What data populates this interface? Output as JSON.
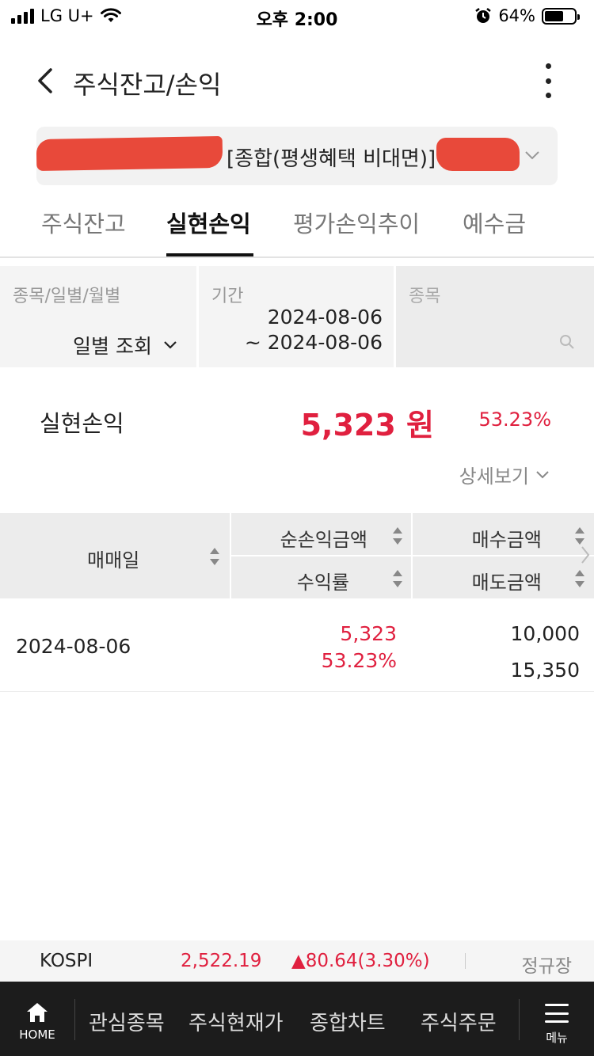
{
  "status_bar": {
    "carrier": "LG U+",
    "time": "오후 2:00",
    "battery": "64%",
    "battery_level": 0.64
  },
  "header": {
    "title": "주식잔고/손익"
  },
  "account": {
    "name": "[종합(평생혜택 비대면)]"
  },
  "tabs": [
    {
      "label": "주식잔고",
      "active": false
    },
    {
      "label": "실현손익",
      "active": true
    },
    {
      "label": "평가손익추이",
      "active": false
    },
    {
      "label": "예수금",
      "active": false
    }
  ],
  "filters": {
    "mode_label": "종목/일별/월별",
    "mode_value": "일별 조회",
    "period_label": "기간",
    "period_from": "2024-08-06",
    "period_to": "~ 2024-08-06",
    "stock_label": "종목"
  },
  "summary": {
    "label": "실현손익",
    "amount": "5,323 원",
    "percent": "53.23%",
    "detail_label": "상세보기"
  },
  "table": {
    "headers": {
      "date": "매매일",
      "net_profit": "순손익금액",
      "return_rate": "수익률",
      "buy_amount": "매수금액",
      "sell_amount": "매도금액"
    },
    "rows": [
      {
        "date": "2024-08-06",
        "net_profit": "5,323",
        "return_rate": "53.23%",
        "buy_amount": "10,000",
        "sell_amount": "15,350"
      }
    ]
  },
  "ticker": {
    "name": "KOSPI",
    "value": "2,522.19",
    "change": "▲80.64(3.30%)",
    "status": "정규장"
  },
  "bottom_nav": {
    "home": "HOME",
    "items": [
      "관심종목",
      "주식현재가",
      "종합차트",
      "주식주문"
    ],
    "menu": "메뉴"
  }
}
